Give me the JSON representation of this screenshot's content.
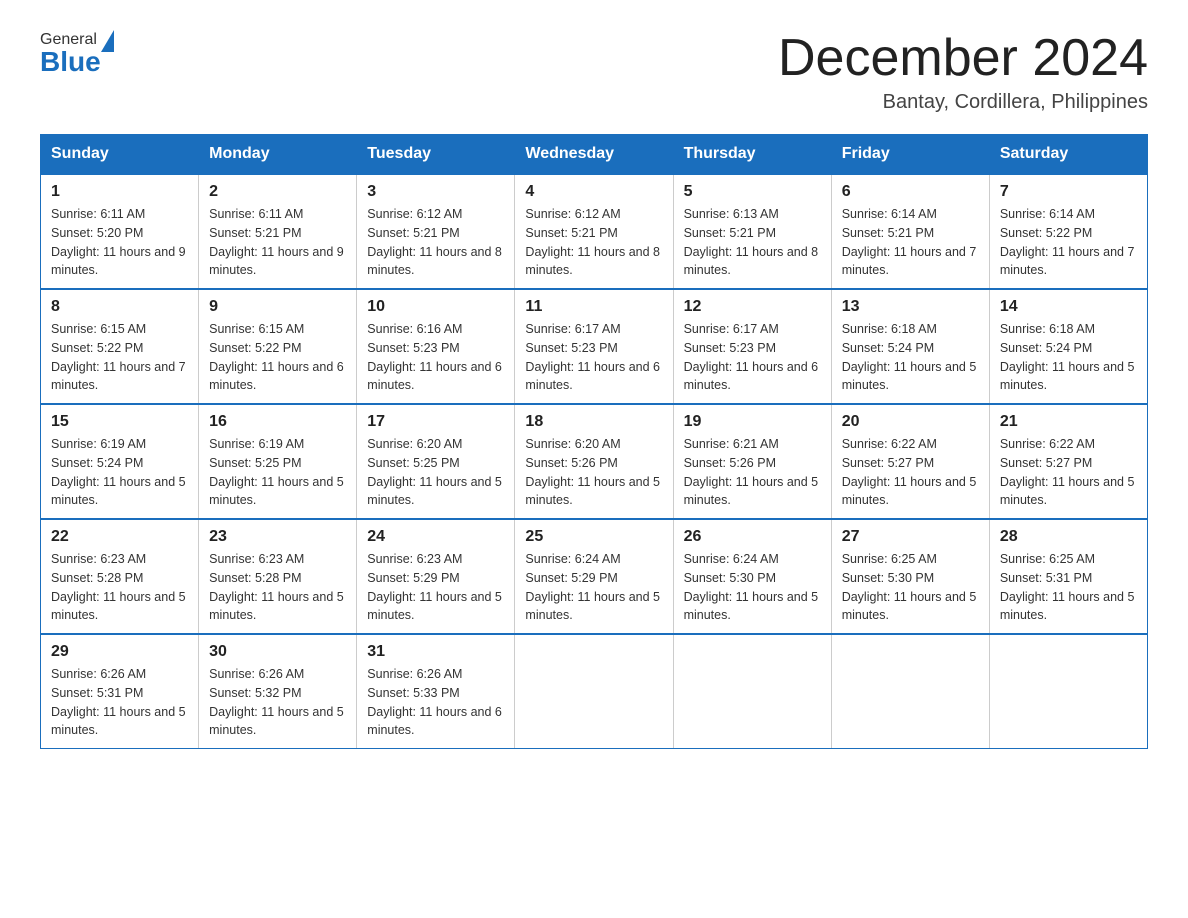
{
  "logo": {
    "general": "General",
    "blue": "Blue"
  },
  "header": {
    "month_year": "December 2024",
    "location": "Bantay, Cordillera, Philippines"
  },
  "days_of_week": [
    "Sunday",
    "Monday",
    "Tuesday",
    "Wednesday",
    "Thursday",
    "Friday",
    "Saturday"
  ],
  "weeks": [
    [
      {
        "day": "1",
        "sunrise": "6:11 AM",
        "sunset": "5:20 PM",
        "daylight": "11 hours and 9 minutes."
      },
      {
        "day": "2",
        "sunrise": "6:11 AM",
        "sunset": "5:21 PM",
        "daylight": "11 hours and 9 minutes."
      },
      {
        "day": "3",
        "sunrise": "6:12 AM",
        "sunset": "5:21 PM",
        "daylight": "11 hours and 8 minutes."
      },
      {
        "day": "4",
        "sunrise": "6:12 AM",
        "sunset": "5:21 PM",
        "daylight": "11 hours and 8 minutes."
      },
      {
        "day": "5",
        "sunrise": "6:13 AM",
        "sunset": "5:21 PM",
        "daylight": "11 hours and 8 minutes."
      },
      {
        "day": "6",
        "sunrise": "6:14 AM",
        "sunset": "5:21 PM",
        "daylight": "11 hours and 7 minutes."
      },
      {
        "day": "7",
        "sunrise": "6:14 AM",
        "sunset": "5:22 PM",
        "daylight": "11 hours and 7 minutes."
      }
    ],
    [
      {
        "day": "8",
        "sunrise": "6:15 AM",
        "sunset": "5:22 PM",
        "daylight": "11 hours and 7 minutes."
      },
      {
        "day": "9",
        "sunrise": "6:15 AM",
        "sunset": "5:22 PM",
        "daylight": "11 hours and 6 minutes."
      },
      {
        "day": "10",
        "sunrise": "6:16 AM",
        "sunset": "5:23 PM",
        "daylight": "11 hours and 6 minutes."
      },
      {
        "day": "11",
        "sunrise": "6:17 AM",
        "sunset": "5:23 PM",
        "daylight": "11 hours and 6 minutes."
      },
      {
        "day": "12",
        "sunrise": "6:17 AM",
        "sunset": "5:23 PM",
        "daylight": "11 hours and 6 minutes."
      },
      {
        "day": "13",
        "sunrise": "6:18 AM",
        "sunset": "5:24 PM",
        "daylight": "11 hours and 5 minutes."
      },
      {
        "day": "14",
        "sunrise": "6:18 AM",
        "sunset": "5:24 PM",
        "daylight": "11 hours and 5 minutes."
      }
    ],
    [
      {
        "day": "15",
        "sunrise": "6:19 AM",
        "sunset": "5:24 PM",
        "daylight": "11 hours and 5 minutes."
      },
      {
        "day": "16",
        "sunrise": "6:19 AM",
        "sunset": "5:25 PM",
        "daylight": "11 hours and 5 minutes."
      },
      {
        "day": "17",
        "sunrise": "6:20 AM",
        "sunset": "5:25 PM",
        "daylight": "11 hours and 5 minutes."
      },
      {
        "day": "18",
        "sunrise": "6:20 AM",
        "sunset": "5:26 PM",
        "daylight": "11 hours and 5 minutes."
      },
      {
        "day": "19",
        "sunrise": "6:21 AM",
        "sunset": "5:26 PM",
        "daylight": "11 hours and 5 minutes."
      },
      {
        "day": "20",
        "sunrise": "6:22 AM",
        "sunset": "5:27 PM",
        "daylight": "11 hours and 5 minutes."
      },
      {
        "day": "21",
        "sunrise": "6:22 AM",
        "sunset": "5:27 PM",
        "daylight": "11 hours and 5 minutes."
      }
    ],
    [
      {
        "day": "22",
        "sunrise": "6:23 AM",
        "sunset": "5:28 PM",
        "daylight": "11 hours and 5 minutes."
      },
      {
        "day": "23",
        "sunrise": "6:23 AM",
        "sunset": "5:28 PM",
        "daylight": "11 hours and 5 minutes."
      },
      {
        "day": "24",
        "sunrise": "6:23 AM",
        "sunset": "5:29 PM",
        "daylight": "11 hours and 5 minutes."
      },
      {
        "day": "25",
        "sunrise": "6:24 AM",
        "sunset": "5:29 PM",
        "daylight": "11 hours and 5 minutes."
      },
      {
        "day": "26",
        "sunrise": "6:24 AM",
        "sunset": "5:30 PM",
        "daylight": "11 hours and 5 minutes."
      },
      {
        "day": "27",
        "sunrise": "6:25 AM",
        "sunset": "5:30 PM",
        "daylight": "11 hours and 5 minutes."
      },
      {
        "day": "28",
        "sunrise": "6:25 AM",
        "sunset": "5:31 PM",
        "daylight": "11 hours and 5 minutes."
      }
    ],
    [
      {
        "day": "29",
        "sunrise": "6:26 AM",
        "sunset": "5:31 PM",
        "daylight": "11 hours and 5 minutes."
      },
      {
        "day": "30",
        "sunrise": "6:26 AM",
        "sunset": "5:32 PM",
        "daylight": "11 hours and 5 minutes."
      },
      {
        "day": "31",
        "sunrise": "6:26 AM",
        "sunset": "5:33 PM",
        "daylight": "11 hours and 6 minutes."
      },
      null,
      null,
      null,
      null
    ]
  ],
  "cell_labels": {
    "sunrise_prefix": "Sunrise: ",
    "sunset_prefix": "Sunset: ",
    "daylight_prefix": "Daylight: "
  }
}
